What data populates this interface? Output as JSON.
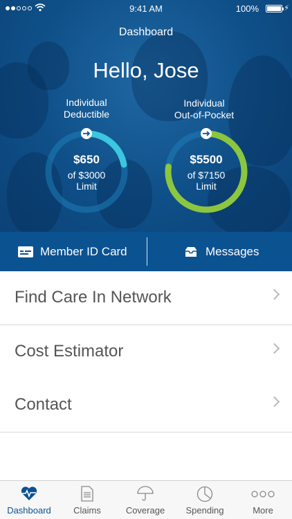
{
  "status": {
    "time": "9:41 AM",
    "battery": "100%"
  },
  "header": {
    "title": "Dashboard",
    "greeting": "Hello, Jose"
  },
  "gauges": [
    {
      "label_line1": "Individual",
      "label_line2": "Deductible",
      "amount": "$650",
      "of_line": "of $3000",
      "limit_word": "Limit",
      "progress": 0.22
    },
    {
      "label_line1": "Individual",
      "label_line2": "Out-of-Pocket",
      "amount": "$5500",
      "of_line": "of $7150",
      "limit_word": "Limit",
      "progress": 0.77
    }
  ],
  "actions": {
    "member_id": "Member ID Card",
    "messages": "Messages"
  },
  "menu": [
    "Find Care In Network",
    "Cost Estimator",
    "Contact"
  ],
  "tabs": [
    "Dashboard",
    "Claims",
    "Coverage",
    "Spending",
    "More"
  ],
  "colors": {
    "primary": "#0b5291",
    "deductible_arc": "#3cc6e0",
    "oop_arc": "#8cc63f"
  }
}
